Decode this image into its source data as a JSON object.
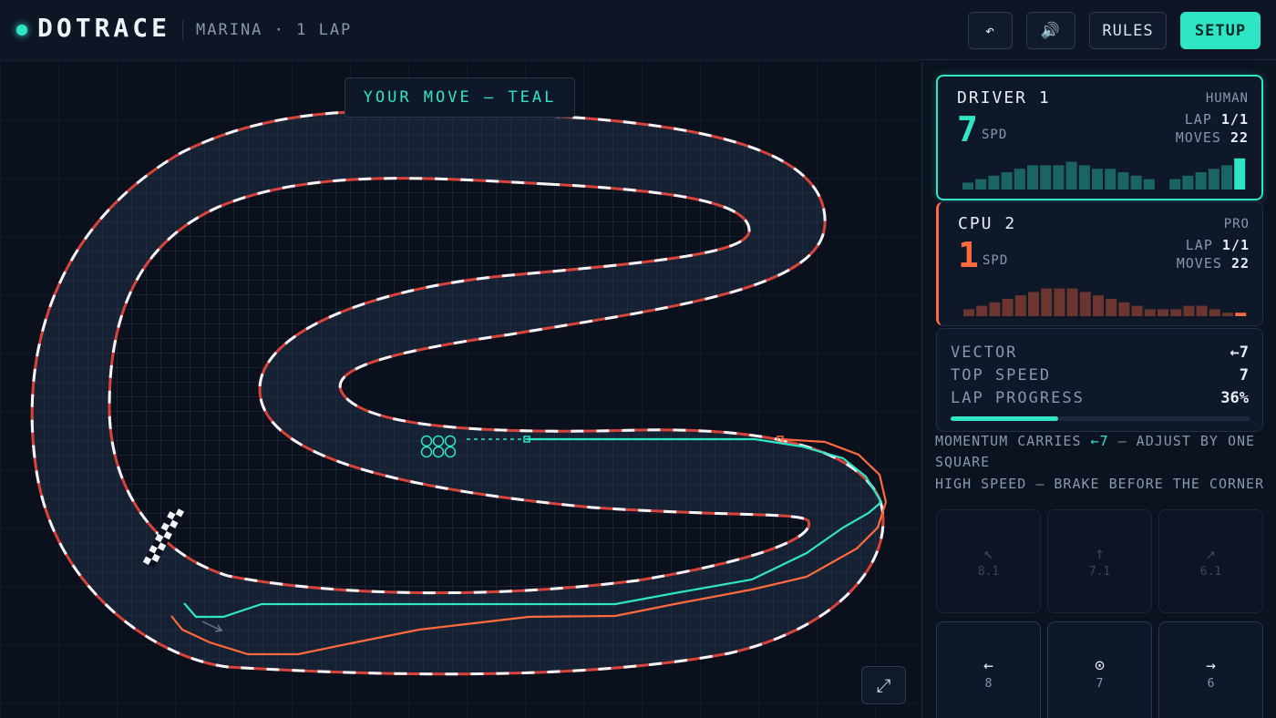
{
  "header": {
    "title": "DOTRACE",
    "subtitle": "MARINA · 1 LAP",
    "undo_label": "↶",
    "sound_label": "🔊",
    "rules_label": "RULES",
    "setup_label": "SETUP"
  },
  "board": {
    "turn_banner": "YOUR MOVE — TEAL",
    "expand_label": "⤢",
    "colors": {
      "player": "#2ee6c5",
      "cpu": "#ff6a3d",
      "curb_red": "#d8443c",
      "curb_white": "#f2f4f7"
    }
  },
  "players": [
    {
      "name": "DRIVER 1",
      "type": "HUMAN",
      "speed": "7",
      "speed_unit": "SPD",
      "lap_label": "LAP",
      "lap": "1/1",
      "moves_label": "MOVES",
      "moves": "22",
      "color": "#2ee6c5",
      "speed_history": [
        2,
        3,
        4,
        5,
        6,
        7,
        7,
        7,
        8,
        7,
        6,
        6,
        5,
        4,
        3,
        0,
        3,
        4,
        5,
        6,
        7,
        9
      ]
    },
    {
      "name": "CPU 2",
      "type": "PRO",
      "speed": "1",
      "speed_unit": "SPD",
      "lap_label": "LAP",
      "lap": "1/1",
      "moves_label": "MOVES",
      "moves": "22",
      "color": "#ff6a3d",
      "speed_history": [
        2,
        3,
        4,
        5,
        6,
        7,
        8,
        8,
        8,
        7,
        6,
        5,
        4,
        3,
        2,
        2,
        2,
        3,
        3,
        2,
        1,
        1
      ]
    }
  ],
  "info": {
    "vector_label": "VECTOR",
    "vector": "←7",
    "top_speed_label": "TOP SPEED",
    "top_speed": "7",
    "lap_progress_label": "LAP PROGRESS",
    "lap_progress": "36%",
    "lap_progress_value": 0.36
  },
  "hints": {
    "line1_prefix": "MOMENTUM CARRIES",
    "line1_vector": "←7",
    "line1_suffix": "— ADJUST BY ONE SQUARE",
    "line2": "HIGH SPEED — BRAKE BEFORE THE CORNER"
  },
  "moves": [
    {
      "arrow": "↖",
      "label": "8.1",
      "enabled": false
    },
    {
      "arrow": "↑",
      "label": "7.1",
      "enabled": false
    },
    {
      "arrow": "↗",
      "label": "6.1",
      "enabled": false
    },
    {
      "arrow": "←",
      "label": "8",
      "enabled": true
    },
    {
      "arrow": "⊙",
      "label": "7",
      "enabled": true
    },
    {
      "arrow": "→",
      "label": "6",
      "enabled": true
    }
  ]
}
